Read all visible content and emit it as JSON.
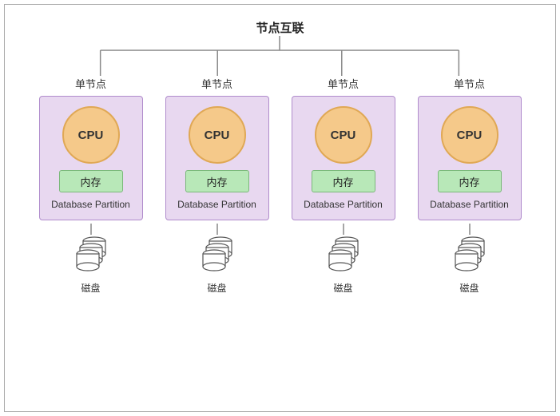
{
  "title": "节点互联",
  "nodes": [
    {
      "label": "单节点",
      "cpu": "CPU",
      "memory": "内存",
      "partition": "Database Partition",
      "disk": "磁盘"
    },
    {
      "label": "单节点",
      "cpu": "CPU",
      "memory": "内存",
      "partition": "Database Partition",
      "disk": "磁盘"
    },
    {
      "label": "单节点",
      "cpu": "CPU",
      "memory": "内存",
      "partition": "Database Partition",
      "disk": "磁盘"
    },
    {
      "label": "单节点",
      "cpu": "CPU",
      "memory": "内存",
      "partition": "Database Partition",
      "disk": "磁盘"
    }
  ],
  "colors": {
    "node_bg": "#e8d8f0",
    "node_border": "#b08ccc",
    "cpu_bg": "#f5c98a",
    "cpu_border": "#e0a855",
    "mem_bg": "#b8e8b8",
    "mem_border": "#7ab87a"
  }
}
